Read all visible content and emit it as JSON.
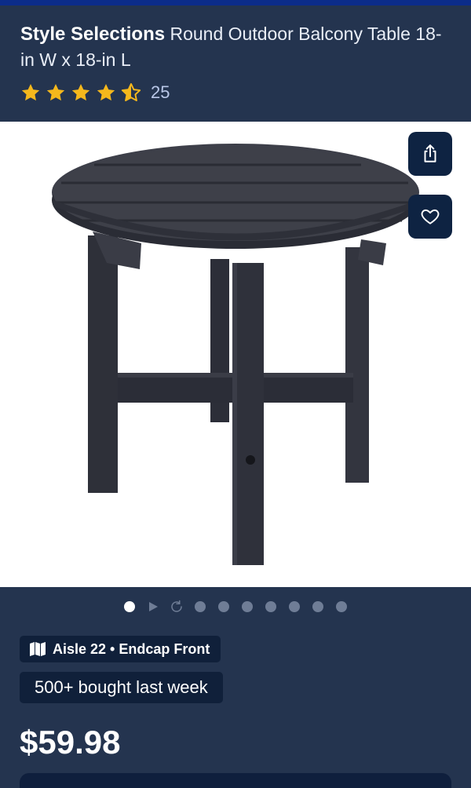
{
  "product": {
    "brand": "Style Selections",
    "name": " Round Outdoor Balcony Table 18-in W x 18-in L",
    "rating": 4.5,
    "rating_max": 5,
    "review_count": "25",
    "star_color": "#f5b81c",
    "price": "$59.98"
  },
  "image": {
    "description_icon": "table-product-image",
    "buttons": {
      "share_icon": "share-icon",
      "favorite_icon": "heart-icon"
    }
  },
  "carousel": {
    "items": [
      "dot-active",
      "play-icon",
      "rotate-icon",
      "dot",
      "dot",
      "dot",
      "dot",
      "dot",
      "dot",
      "dot"
    ],
    "active_index": 0
  },
  "location": {
    "icon": "map-icon",
    "label": "Aisle 22 • Endcap Front"
  },
  "social_proof": {
    "label": "500+ bought last week"
  },
  "colors": {
    "header_bg": "#24344f",
    "chip_bg": "#10203a",
    "button_bg": "#0e2342",
    "accent_strip": "#0b2c8a"
  }
}
